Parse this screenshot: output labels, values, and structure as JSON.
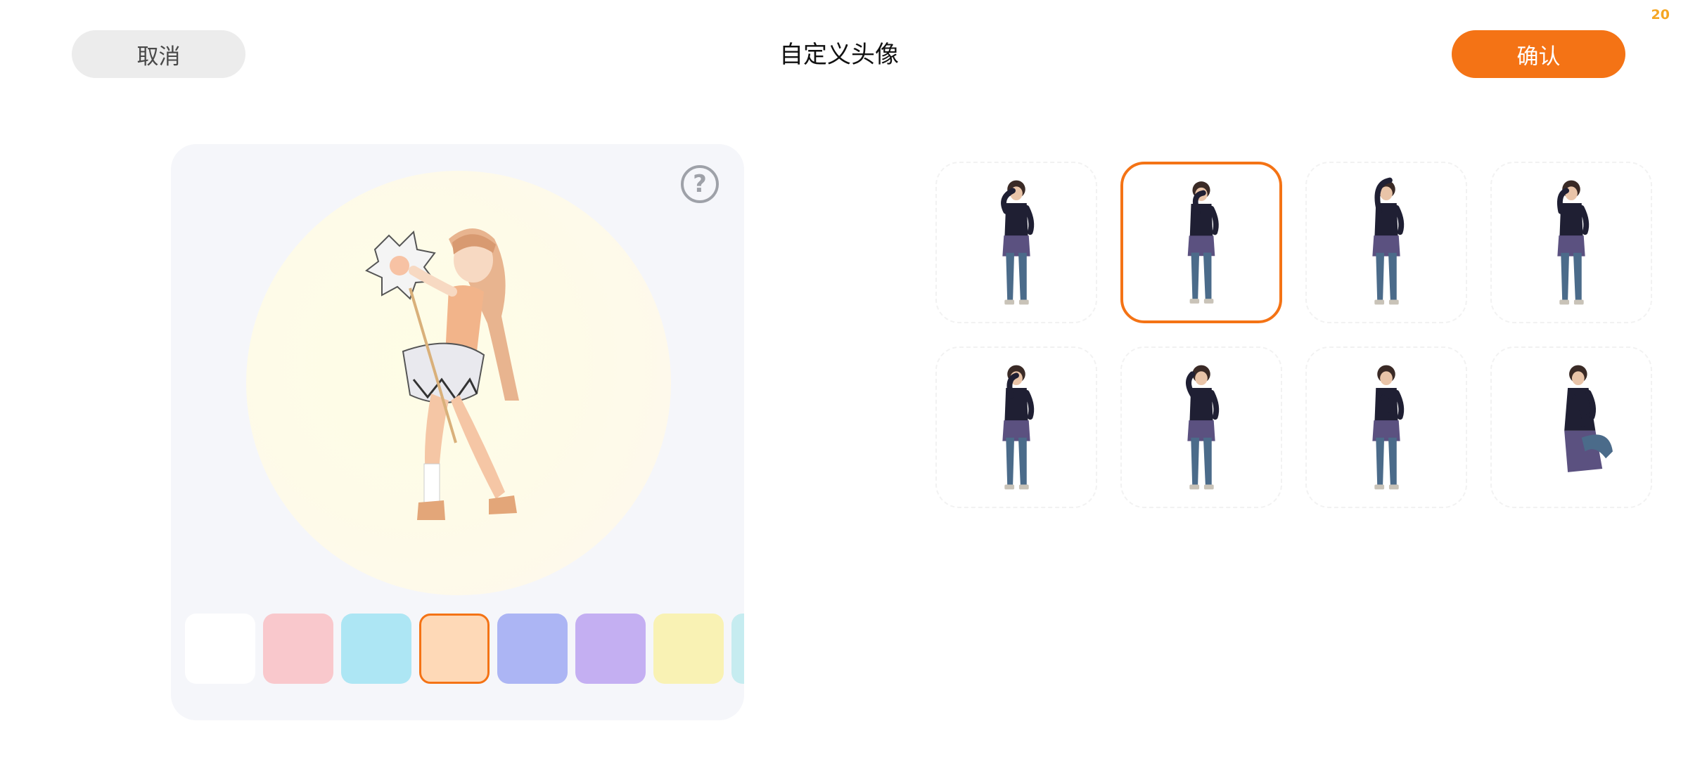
{
  "status": {
    "fps": "20"
  },
  "header": {
    "cancel_label": "取消",
    "title": "自定义头像",
    "confirm_label": "确认"
  },
  "preview": {
    "help_glyph": "?",
    "help_icon": "question-circle-icon",
    "background_colors": [
      {
        "name": "white",
        "hex": "#ffffff"
      },
      {
        "name": "pink",
        "hex": "#f9c8cc"
      },
      {
        "name": "light-blue",
        "hex": "#ade6f4"
      },
      {
        "name": "peach",
        "hex": "#fed9b7",
        "selected": true
      },
      {
        "name": "periwinkle",
        "hex": "#acb5f4"
      },
      {
        "name": "lavender",
        "hex": "#c4aff2"
      },
      {
        "name": "pale-yellow",
        "hex": "#f9f2b4"
      },
      {
        "name": "cyan-partial",
        "hex": "#c6ecf0"
      }
    ]
  },
  "poses": {
    "selected_index": 1,
    "count": 8
  },
  "colors": {
    "accent": "#f47315",
    "panel": "#f5f6fa"
  }
}
